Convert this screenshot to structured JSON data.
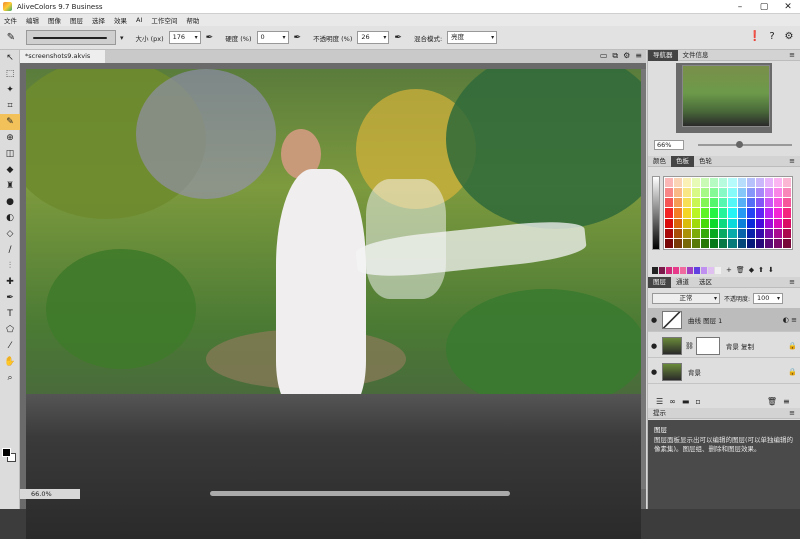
{
  "window": {
    "title": "AliveColors 9.7 Business"
  },
  "menu": [
    "文件",
    "编辑",
    "图像",
    "图层",
    "选择",
    "效果",
    "AI",
    "工作空间",
    "帮助"
  ],
  "options": {
    "size_label": "大小 (px)",
    "size_value": "176",
    "hardness_label": "硬度 (%)",
    "hardness_value": "0",
    "opacity_label": "不透明度 (%)",
    "opacity_value": "26",
    "blend_label": "混合模式:",
    "blend_value": "亮度"
  },
  "document": {
    "tab": "*screenshots9.akvis",
    "zoom": "66.0%"
  },
  "navigator": {
    "tabs": [
      "导航器",
      "文件信息"
    ],
    "zoom": "66%"
  },
  "colors": {
    "tabs": [
      "颜色",
      "色板",
      "色轮"
    ]
  },
  "layers": {
    "tabs": [
      "图层",
      "通道",
      "选区"
    ],
    "blend": "正常",
    "opacity_label": "不透明度:",
    "opacity": "100",
    "items": [
      {
        "name": "曲线 图层 1"
      },
      {
        "name": "背景 复制"
      },
      {
        "name": "背景"
      }
    ]
  },
  "hint": {
    "tab": "提示",
    "title": "图层",
    "text": "图层面板显示出可以编辑的图层(可以单独编辑的像素集)。图层组、删除和图层效果。"
  }
}
